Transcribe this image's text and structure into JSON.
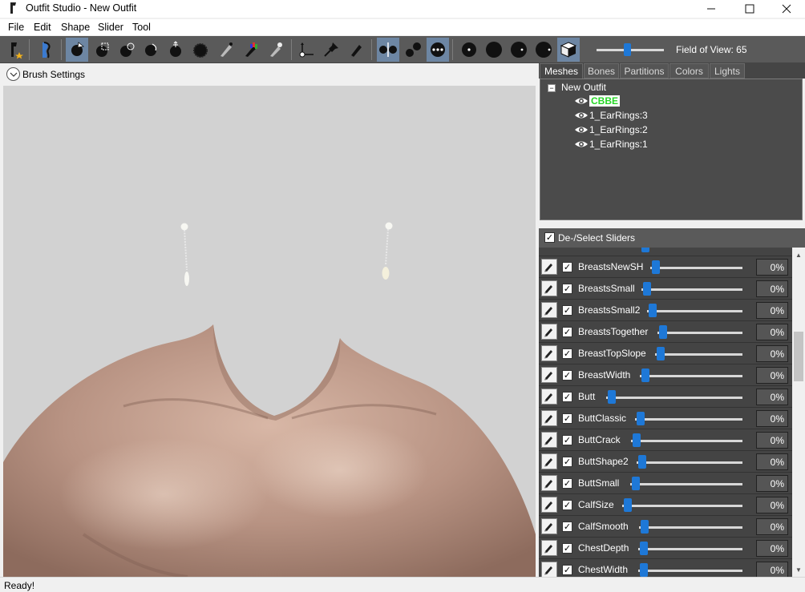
{
  "window": {
    "title": "Outfit Studio - New Outfit",
    "minimize_icon": "minimize-icon",
    "maximize_icon": "maximize-icon",
    "close_icon": "close-icon"
  },
  "menu": [
    "File",
    "Edit",
    "Shape",
    "Slider",
    "Tool"
  ],
  "toolbar": {
    "fov_label": "Field of View: 65",
    "fov_value": 65
  },
  "brush_settings": {
    "label": "Brush Settings"
  },
  "tabs": [
    "Meshes",
    "Bones",
    "Partitions",
    "Colors",
    "Lights"
  ],
  "tree": {
    "root": "New Outfit",
    "items": [
      {
        "label": "CBBE",
        "selected": true
      },
      {
        "label": "1_EarRings:3",
        "selected": false
      },
      {
        "label": "1_EarRings:2",
        "selected": false
      },
      {
        "label": "1_EarRings:1",
        "selected": false
      }
    ]
  },
  "sliders_header": "De-/Select Sliders",
  "sliders": [
    {
      "name": "BreastsNewSH",
      "value": "0%"
    },
    {
      "name": "BreastsSmall",
      "value": "0%"
    },
    {
      "name": "BreastsSmall2",
      "value": "0%"
    },
    {
      "name": "BreastsTogether",
      "value": "0%"
    },
    {
      "name": "BreastTopSlope",
      "value": "0%"
    },
    {
      "name": "BreastWidth",
      "value": "0%"
    },
    {
      "name": "Butt",
      "value": "0%"
    },
    {
      "name": "ButtClassic",
      "value": "0%"
    },
    {
      "name": "ButtCrack",
      "value": "0%"
    },
    {
      "name": "ButtShape2",
      "value": "0%"
    },
    {
      "name": "ButtSmall",
      "value": "0%"
    },
    {
      "name": "CalfSize",
      "value": "0%"
    },
    {
      "name": "CalfSmooth",
      "value": "0%"
    },
    {
      "name": "ChestDepth",
      "value": "0%"
    },
    {
      "name": "ChestWidth",
      "value": "0%"
    }
  ],
  "status": "Ready!",
  "colors": {
    "toolbar": "#5a5a5a",
    "panel": "#444444",
    "accent": "#1e78d7",
    "selected_mesh": "#26d626",
    "viewport": "#d2d2d2"
  }
}
